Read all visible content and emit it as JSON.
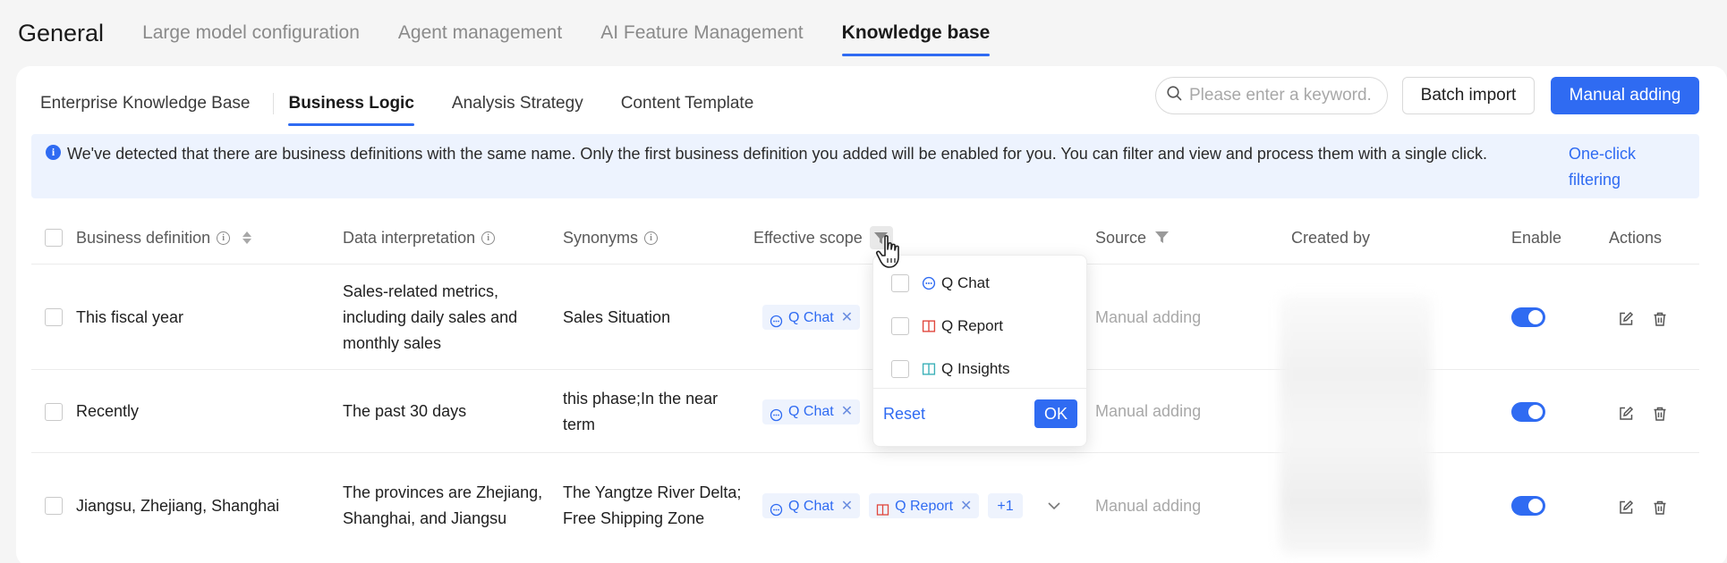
{
  "topnav": {
    "brand": "General",
    "tabs": [
      "Large model configuration",
      "Agent management",
      "AI Feature Management",
      "Knowledge base"
    ],
    "active_index": 3
  },
  "subtabs": {
    "items": [
      "Enterprise Knowledge Base",
      "Business Logic",
      "Analysis Strategy",
      "Content Template"
    ],
    "active_index": 1
  },
  "toolbar": {
    "search_placeholder": "Please enter a keyword.",
    "batch_import": "Batch import",
    "manual_adding": "Manual adding"
  },
  "alert": {
    "message": "We've detected that there are business definitions with the same name. Only the first business definition you added will be enabled for you. You can filter and view and process them with a single click.",
    "link": "One-click filtering"
  },
  "table": {
    "headers": {
      "business_definition": "Business definition",
      "data_interpretation": "Data interpretation",
      "synonyms": "Synonyms",
      "effective_scope": "Effective scope",
      "source": "Source",
      "created_by": "Created by",
      "enable": "Enable",
      "actions": "Actions"
    },
    "rows": [
      {
        "definition": "This fiscal year",
        "interpretation": "Sales-related metrics, including daily sales and monthly sales",
        "synonyms": "Sales Situation",
        "tags": [
          "Q Chat"
        ],
        "source": "Manual adding",
        "enabled": true
      },
      {
        "definition": "Recently",
        "interpretation": "The past 30 days",
        "synonyms": "this phase;In the near term",
        "tags": [
          "Q Chat"
        ],
        "source": "Manual adding",
        "enabled": true
      },
      {
        "definition": "Jiangsu, Zhejiang, Shanghai",
        "interpretation": "The provinces are Zhejiang, Shanghai, and Jiangsu",
        "synonyms": "The Yangtze River Delta; Free Shipping Zone",
        "tags": [
          "Q Chat",
          "Q Report"
        ],
        "more": "+1",
        "source": "Manual adding",
        "enabled": true
      }
    ]
  },
  "filter_dropdown": {
    "options": [
      "Q Chat",
      "Q Report",
      "Q Insights"
    ],
    "reset": "Reset",
    "ok": "OK"
  },
  "colors": {
    "primary": "#2f6bf2",
    "alert_bg": "#edf3fe",
    "report_red": "#e0483e",
    "insights_teal": "#3bb0b8"
  }
}
